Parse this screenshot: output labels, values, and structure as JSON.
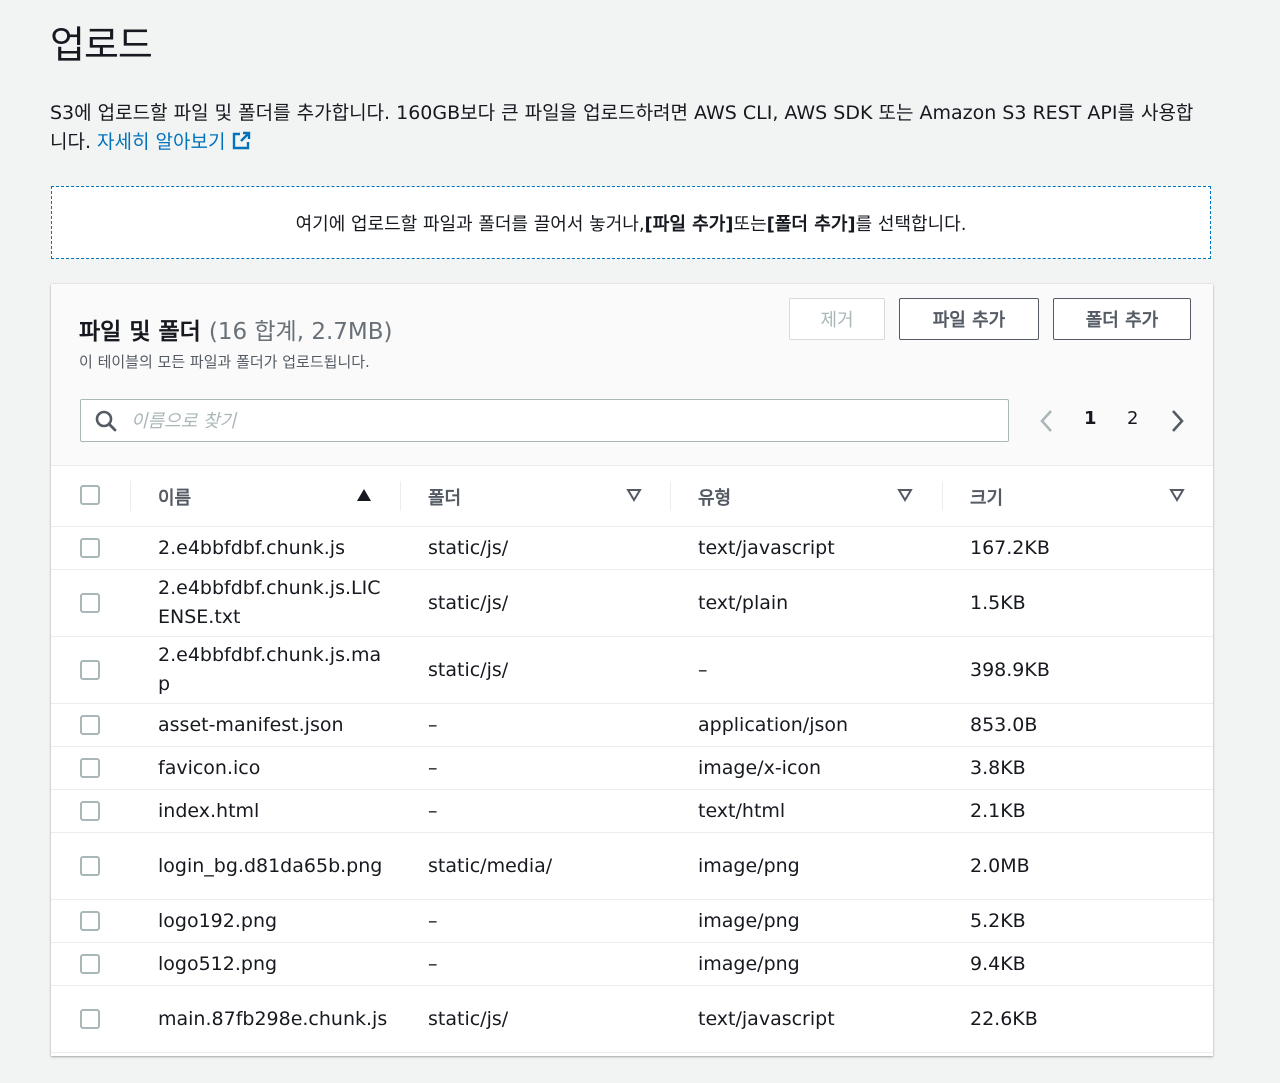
{
  "page": {
    "title": "업로드",
    "description": "S3에 업로드할 파일 및 폴더를 추가합니다. 160GB보다 큰 파일을 업로드하려면 AWS CLI, AWS SDK 또는 Amazon S3 REST API를 사용합니다.",
    "learn_more": "자세히 알아보기"
  },
  "dropzone": {
    "prefix": "여기에 업로드할 파일과 폴더를 끌어서 놓거나, ",
    "add_files": "[파일 추가]",
    "middle": " 또는 ",
    "add_folder": "[폴더 추가]",
    "suffix": "를 선택합니다."
  },
  "panel": {
    "title": "파일 및 폴더",
    "count": "(16 합계, 2.7MB)",
    "subtitle": "이 테이블의 모든 파일과 폴더가 업로드됩니다.",
    "remove_label": "제거",
    "add_files_label": "파일 추가",
    "add_folder_label": "폴더 추가",
    "search_placeholder": "이름으로 찾기",
    "pages": [
      "1",
      "2"
    ],
    "current_page": "1"
  },
  "table": {
    "columns": [
      "이름",
      "폴더",
      "유형",
      "크기"
    ],
    "sort": {
      "column": "이름",
      "direction": "ascending"
    },
    "rows": [
      {
        "name": "2.e4bbfdbf.chunk.js",
        "folder": "static/js/",
        "type": "text/javascript",
        "size": "167.2KB"
      },
      {
        "name": "2.e4bbfdbf.chunk.js.LICENSE.txt",
        "folder": "static/js/",
        "type": "text/plain",
        "size": "1.5KB"
      },
      {
        "name": "2.e4bbfdbf.chunk.js.map",
        "folder": "static/js/",
        "type": "–",
        "size": "398.9KB"
      },
      {
        "name": "asset-manifest.json",
        "folder": "–",
        "type": "application/json",
        "size": "853.0B"
      },
      {
        "name": "favicon.ico",
        "folder": "–",
        "type": "image/x-icon",
        "size": "3.8KB"
      },
      {
        "name": "index.html",
        "folder": "–",
        "type": "text/html",
        "size": "2.1KB"
      },
      {
        "name": "login_bg.d81da65b.png",
        "folder": "static/media/",
        "type": "image/png",
        "size": "2.0MB"
      },
      {
        "name": "logo192.png",
        "folder": "–",
        "type": "image/png",
        "size": "5.2KB"
      },
      {
        "name": "logo512.png",
        "folder": "–",
        "type": "image/png",
        "size": "9.4KB"
      },
      {
        "name": "main.87fb298e.chunk.js",
        "folder": "static/js/",
        "type": "text/javascript",
        "size": "22.6KB"
      }
    ]
  },
  "colors": {
    "accent": "#0073bb",
    "background": "#f2f3f3",
    "text": "#16191f",
    "muted": "#545b64"
  }
}
